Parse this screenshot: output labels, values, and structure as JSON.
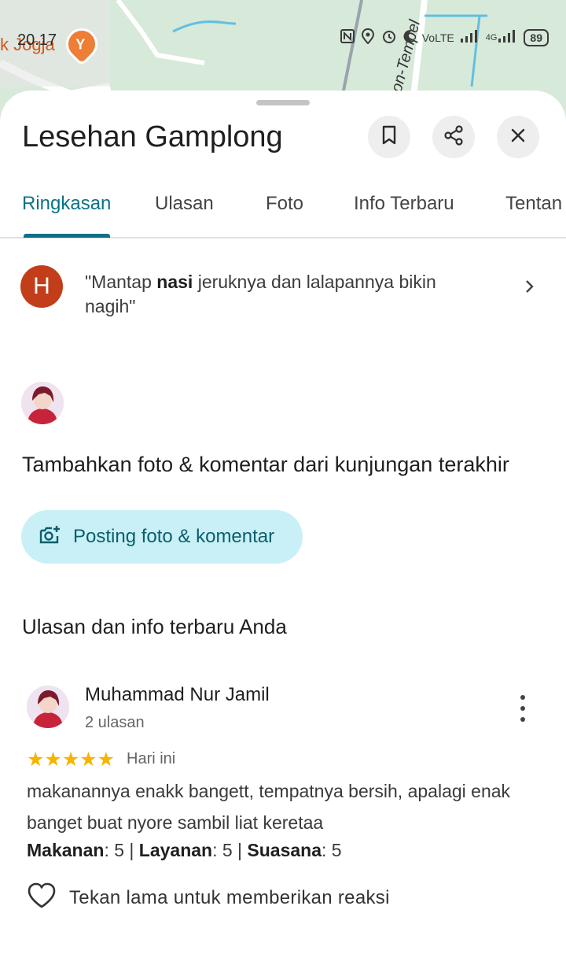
{
  "status_bar": {
    "time": "20.17",
    "volte": "VoLTE",
    "network": "4G",
    "battery": "89"
  },
  "map": {
    "place_label": "k Jogja",
    "street_label": "on-Tempel"
  },
  "place": {
    "title": "Lesehan Gamplong"
  },
  "tabs": [
    {
      "label": "Ringkasan",
      "active": true
    },
    {
      "label": "Ulasan",
      "active": false
    },
    {
      "label": "Foto",
      "active": false
    },
    {
      "label": "Info Terbaru",
      "active": false
    },
    {
      "label": "Tentan",
      "active": false
    }
  ],
  "snippet": {
    "avatar_letter": "H",
    "quote_open": "\"Mantap ",
    "quote_bold": "nasi",
    "quote_rest": " jeruknya dan lalapannya bikin nagih\""
  },
  "add_section": {
    "title": "Tambahkan foto & komentar dari kunjungan terakhir",
    "button_label": "Posting foto & komentar"
  },
  "your_reviews": {
    "section_title": "Ulasan dan info terbaru Anda",
    "reviewer_name": "Muhammad Nur Jamil",
    "reviewer_count": "2 ulasan",
    "rating": 5,
    "stars": "★★★★★",
    "date": "Hari ini",
    "body": "makanannya enakk bangett, tempatnya bersih, apalagi enak banget buat nyore sambil liat keretaa",
    "ratings": {
      "food_label": "Makanan",
      "food_value": ": 5 | ",
      "service_label": "Layanan",
      "service_value": ": 5 | ",
      "atmosphere_label": "Suasana",
      "atmosphere_value": ": 5"
    },
    "react_label": "Tekan lama untuk memberikan reaksi"
  },
  "colors": {
    "accent": "#0b7285",
    "post_button_bg": "#c9f0f7",
    "star": "#f6b400",
    "avatar_letter_bg": "#c23d1a"
  },
  "icons": [
    "bookmark-icon",
    "share-icon",
    "close-icon",
    "chevron-right-icon",
    "add-photo-icon",
    "more-vert-icon",
    "heart-outline-icon"
  ]
}
